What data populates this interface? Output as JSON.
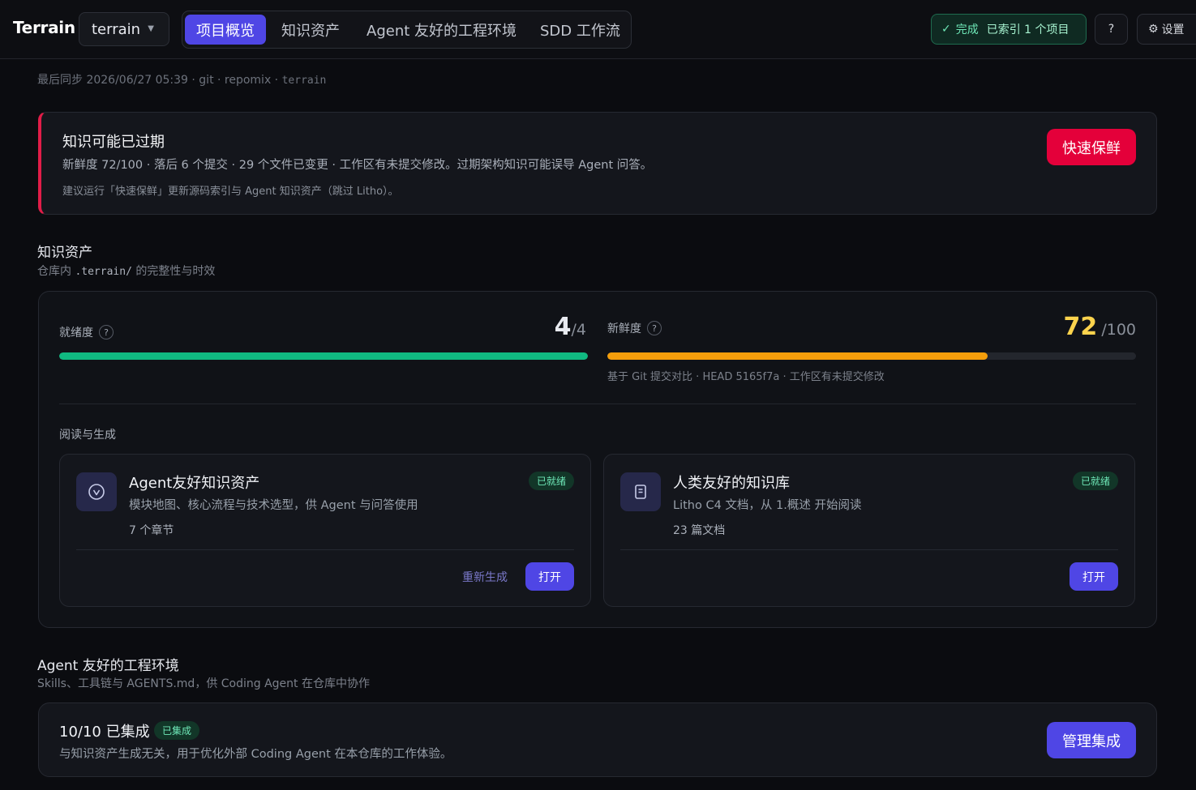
{
  "header": {
    "brand": "Terrain",
    "project": "terrain",
    "tabs": [
      {
        "label": "项目概览",
        "active": true
      },
      {
        "label": "知识资产",
        "active": false
      },
      {
        "label": "Agent 友好的工程环境",
        "active": false
      },
      {
        "label": "SDD 工作流",
        "active": false
      }
    ],
    "status": {
      "state": "完成",
      "detail": "已索引 1 个项目"
    },
    "help_label": "?",
    "settings_label": "设置"
  },
  "sync": {
    "prefix": "最后同步 2026/06/27 05:39 · git · repomix · ",
    "branch": "terrain"
  },
  "alert": {
    "title": "知识可能已过期",
    "description": "新鲜度 72/100 · 落后 6 个提交 · 29 个文件已变更 · 工作区有未提交修改。过期架构知识可能误导 Agent 问答。",
    "hint": "建议运行「快速保鲜」更新源码索引与 Agent 知识资产（跳过 Litho）。",
    "action_label": "快速保鲜",
    "accent_color": "#e11d48"
  },
  "assets": {
    "title": "知识资产",
    "subtitle_prefix": "仓库内 ",
    "subtitle_path": ".terrain/",
    "subtitle_suffix": " 的完整性与时效",
    "readiness": {
      "label": "就绪度",
      "value": "4",
      "denominator": "/4",
      "fraction": 1.0,
      "color": "#10b981"
    },
    "freshness": {
      "label": "新鲜度",
      "value": "72",
      "denominator": "/100",
      "fraction": 0.72,
      "color": "#f59e0b",
      "value_color": "#fcd34d",
      "note": "基于 Git 提交对比 · HEAD 5165f7a · 工作区有未提交修改"
    },
    "read_label": "阅读与生成",
    "cards": [
      {
        "title": "Agent友好知识资产",
        "description": "模块地图、核心流程与技术选型，供 Agent 与问答使用",
        "count": "7 个章节",
        "badge": "已就绪",
        "regenerate_label": "重新生成",
        "open_label": "打开",
        "icon": "compass-icon"
      },
      {
        "title": "人类友好的知识库",
        "description": "Litho C4 文档，从 1.概述 开始阅读",
        "count": "23 篇文档",
        "badge": "已就绪",
        "open_label": "打开",
        "icon": "book-icon"
      }
    ]
  },
  "engineering": {
    "title": "Agent 友好的工程环境",
    "subtitle": "Skills、工具链与 AGENTS.md，供 Coding Agent 在仓库中协作",
    "integrations_title": "10/10 已集成",
    "badge": "已集成",
    "description": "与知识资产生成无关，用于优化外部 Coding Agent 在本仓库的工作体验。",
    "action_label": "管理集成"
  }
}
